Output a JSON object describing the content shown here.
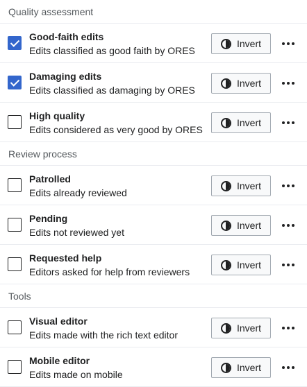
{
  "sections": [
    {
      "title": "Quality assessment",
      "items": [
        {
          "title": "Good-faith edits",
          "desc": "Edits classified as good faith by ORES",
          "checked": true
        },
        {
          "title": "Damaging edits",
          "desc": "Edits classified as damaging by ORES",
          "checked": true
        },
        {
          "title": "High quality",
          "desc": "Edits considered as very good by ORES",
          "checked": false
        }
      ]
    },
    {
      "title": "Review process",
      "items": [
        {
          "title": "Patrolled",
          "desc": "Edits already reviewed",
          "checked": false
        },
        {
          "title": "Pending",
          "desc": "Edits not reviewed yet",
          "checked": false
        },
        {
          "title": "Requested help",
          "desc": "Editors asked for help from reviewers",
          "checked": false
        }
      ]
    },
    {
      "title": "Tools",
      "items": [
        {
          "title": "Visual editor",
          "desc": "Edits made with the rich text editor",
          "checked": false
        },
        {
          "title": "Mobile editor",
          "desc": "Edits made on mobile",
          "checked": false
        }
      ]
    }
  ],
  "invert_label": "Invert",
  "icons": {
    "invert": "half-circle-icon",
    "more": "more-horizontal-icon",
    "check": "checkmark-icon"
  },
  "colors": {
    "accent": "#3366cc",
    "divider": "#eaecf0",
    "header_text": "#54595d"
  }
}
